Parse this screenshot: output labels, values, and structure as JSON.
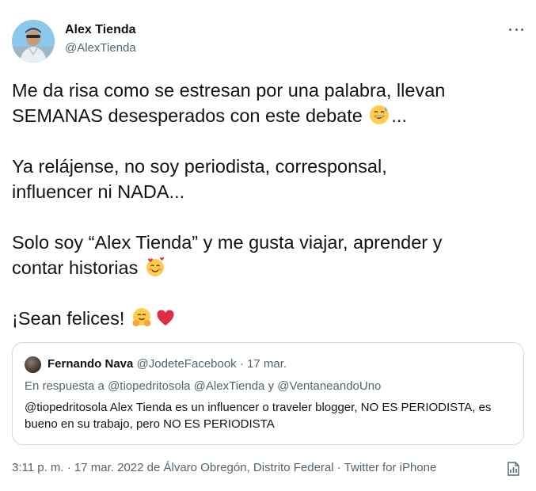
{
  "author": {
    "name": "Alex Tienda",
    "handle": "@AlexTienda"
  },
  "tweet": {
    "paragraphs": [
      {
        "lines": [
          {
            "text": "Me da risa como se estresan por una palabra, llevan"
          },
          {
            "text": "SEMANAS desesperados con este debate",
            "emoji": "grinning-sweat-emoji",
            "after": "..."
          }
        ]
      },
      {
        "lines": [
          {
            "text": "Ya relájense, no soy periodista, corresponsal,"
          },
          {
            "text": "influencer ni NADA..."
          }
        ]
      },
      {
        "lines": [
          {
            "text": "Solo soy “Alex Tienda” y me gusta viajar, aprender y"
          },
          {
            "text": "contar historias",
            "emoji": "smiling-hearts-emoji"
          }
        ]
      },
      {
        "lines": [
          {
            "text": "¡Sean felices!",
            "emoji": "hugging-emoji",
            "emoji2": "red-heart-emoji"
          }
        ]
      }
    ]
  },
  "quoted": {
    "name": "Fernando Nava",
    "meta": "@JodeteFacebook · 17 mar.",
    "reply_line": "En respuesta a @tiopedritosola @AlexTienda y @VentaneandoUno",
    "text": "@tiopedritosola Alex Tienda es un influencer o traveler blogger, NO ES PERIODISTA, es bueno en su trabajo, pero NO ES PERIODISTA"
  },
  "footer": {
    "text": "3:11 p. m. · 17 mar. 2022 de Álvaro Obregón, Distrito Federal · Twitter for iPhone"
  },
  "icons": [
    "more-options-icon",
    "analytics-icon"
  ],
  "colors": {
    "text": "#0f1419",
    "secondary": "#536471",
    "border": "#cfd9de",
    "heart": "#e0245e",
    "emoji_yellow": "#ffcc4d"
  }
}
